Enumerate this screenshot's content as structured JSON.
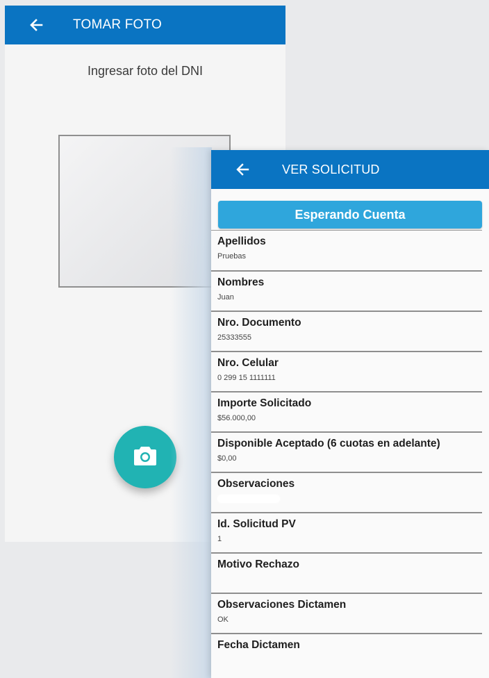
{
  "foto_screen": {
    "title": "TOMAR FOTO",
    "back_icon": "arrow-left-icon",
    "subtitle": "Ingresar foto del DNI",
    "camera_icon": "camera-icon"
  },
  "solicitud_screen": {
    "title": "VER SOLICITUD",
    "back_icon": "arrow-left-icon",
    "status_button": "Esperando Cuenta",
    "fields": [
      {
        "label": "Apellidos",
        "value": "Pruebas"
      },
      {
        "label": "Nombres",
        "value": "Juan"
      },
      {
        "label": "Nro. Documento",
        "value": "25333555"
      },
      {
        "label": "Nro. Celular",
        "value": "0 299 15 1111111"
      },
      {
        "label": "Importe Solicitado",
        "value": "$56.000,00"
      },
      {
        "label": "Disponible Aceptado (6 cuotas en adelante)",
        "value": "$0,00"
      },
      {
        "label": "Observaciones",
        "value": ""
      },
      {
        "label": "Id. Solicitud PV",
        "value": "1"
      },
      {
        "label": "Motivo Rechazo",
        "value": ""
      },
      {
        "label": "Observaciones Dictamen",
        "value": "OK"
      },
      {
        "label": "Fecha Dictamen",
        "value": ""
      }
    ]
  },
  "colors": {
    "appbar": "#0a74c2",
    "status_button": "#2fa6dc",
    "camera_fab": "#21b3b3"
  }
}
